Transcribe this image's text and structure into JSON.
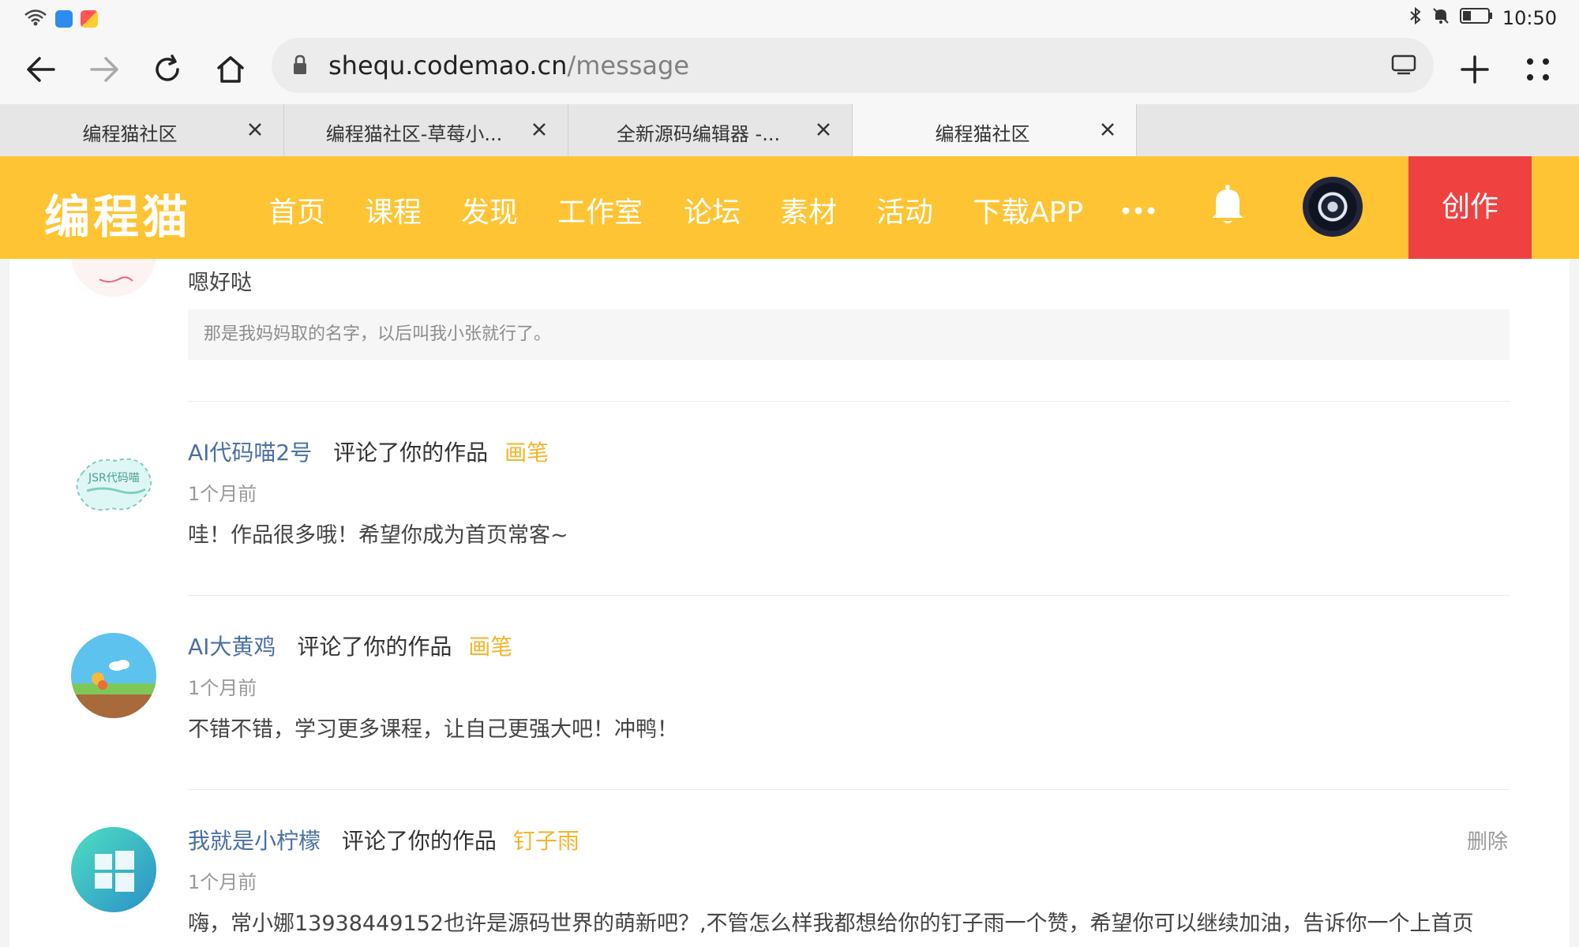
{
  "status_bar": {
    "time": "10:50"
  },
  "address_bar": {
    "domain": "shequ.codemao.cn",
    "path": "/message"
  },
  "tabs": [
    {
      "label": "编程猫社区"
    },
    {
      "label": "编程猫社区-草莓小..."
    },
    {
      "label": "全新源码编辑器 -..."
    },
    {
      "label": "编程猫社区"
    }
  ],
  "site_nav": {
    "logo": "编程猫",
    "items": [
      "首页",
      "课程",
      "发现",
      "工作室",
      "论坛",
      "素材",
      "活动",
      "下载APP"
    ],
    "create_label": "创作"
  },
  "messages": {
    "partial": {
      "body": "嗯好哒",
      "quote": "那是我妈妈取的名字，以后叫我小张就行了。"
    },
    "items": [
      {
        "user": "AI代码喵2号",
        "action": "评论了你的作品",
        "work": "画笔",
        "time": "1个月前",
        "body": "哇！作品很多哦！希望你成为首页常客~"
      },
      {
        "user": "AI大黄鸡",
        "action": "评论了你的作品",
        "work": "画笔",
        "time": "1个月前",
        "body": "不错不错，学习更多课程，让自己更强大吧！冲鸭！"
      },
      {
        "user": "我就是小柠檬",
        "action": "评论了你的作品",
        "work": "钉子雨",
        "time": "1个月前",
        "body": "嗨，常小娜13938449152也许是源码世界的萌新吧？,不管怎么样我都想给你的钉子雨一个赞，希望你可以继续加油，告诉你一个上首页",
        "delete_label": "删除"
      }
    ]
  },
  "colors": {
    "brand": "#fec433",
    "create": "#f04141",
    "link": "#4a6fa5",
    "work": "#f5b52a"
  }
}
